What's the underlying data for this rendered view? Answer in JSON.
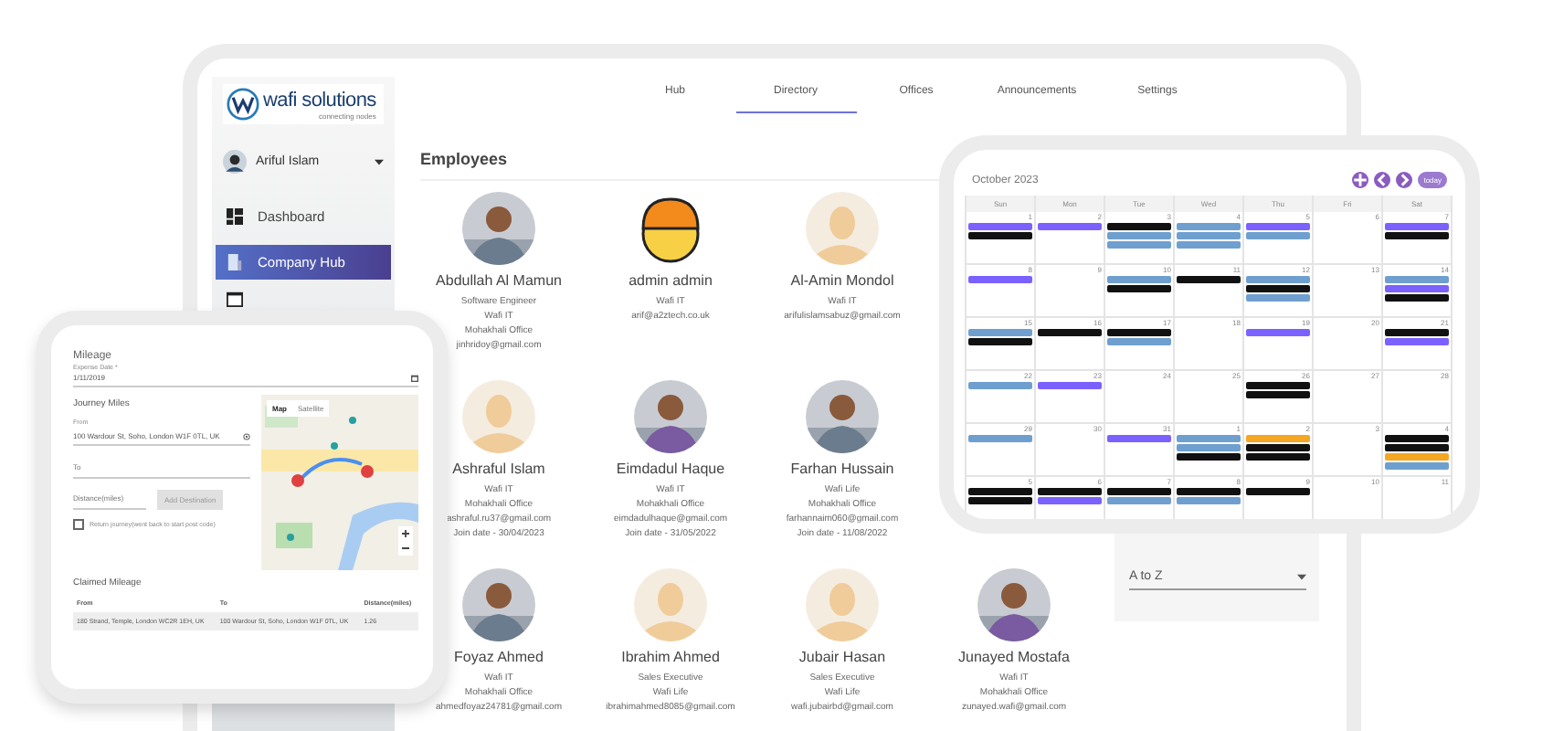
{
  "logo": {
    "name": "wafi solutions",
    "tagline": "connecting nodes"
  },
  "user": {
    "name": "Ariful Islam"
  },
  "sidebar": {
    "items": [
      {
        "label": "Dashboard",
        "selected": false
      },
      {
        "label": "Company Hub",
        "selected": true
      }
    ]
  },
  "tabs": [
    {
      "label": "Hub",
      "selected": false
    },
    {
      "label": "Directory",
      "selected": true
    },
    {
      "label": "Offices",
      "selected": false
    },
    {
      "label": "Announcements",
      "selected": false
    },
    {
      "label": "Settings",
      "selected": false
    }
  ],
  "directory": {
    "title": "Employees",
    "employees": [
      {
        "name": "Abdullah Al Mamun",
        "details": [
          "Software Engineer",
          "Wafi IT",
          "Mohakhali Office",
          "jinhridoy@gmail.com"
        ]
      },
      {
        "name": "admin admin",
        "kind": "helmet",
        "details": [
          "Wafi IT",
          "arif@a2ztech.co.uk"
        ]
      },
      {
        "name": "Al-Amin Mondol",
        "kind": "default",
        "details": [
          "Wafi IT",
          "arifulislamsabuz@gmail.com"
        ]
      },
      {
        "kind": "hidden"
      },
      {
        "name": "Ashraful Islam",
        "kind": "default",
        "details": [
          "Wafi IT",
          "Mohakhali Office",
          "ashraful.ru37@gmail.com",
          "Join date - 30/04/2023"
        ]
      },
      {
        "name": "Eimdadul Haque",
        "details": [
          "Wafi IT",
          "Mohakhali Office",
          "eimdadulhaque@gmail.com",
          "Join date - 31/05/2022"
        ]
      },
      {
        "name": "Farhan Hussain",
        "details": [
          "Wafi Life",
          "Mohakhali Office",
          "farhannaim060@gmail.com",
          "Join date - 11/08/2022"
        ]
      },
      {
        "kind": "hidden"
      },
      {
        "name": "Foyaz Ahmed",
        "details": [
          "Wafi IT",
          "Mohakhali Office",
          "ahmedfoyaz24781@gmail.com"
        ]
      },
      {
        "name": "Ibrahim Ahmed",
        "kind": "default",
        "details": [
          "Sales Executive",
          "Wafi Life",
          "ibrahimahmed8085@gmail.com"
        ]
      },
      {
        "name": "Jubair Hasan",
        "kind": "default",
        "details": [
          "Sales Executive",
          "Wafi Life",
          "wafi.jubairbd@gmail.com"
        ]
      },
      {
        "name": "Junayed Mostafa",
        "details": [
          "Wafi IT",
          "Mohakhali Office",
          "zunayed.wafi@gmail.com"
        ]
      }
    ]
  },
  "sort_field": {
    "value": "A to Z"
  },
  "calendar": {
    "title": "October 2023",
    "today_button": "today",
    "weekdays": [
      "Sun",
      "Mon",
      "Tue",
      "Wed",
      "Thu",
      "Fri",
      "Sat"
    ],
    "weeks": [
      [
        {
          "date": "1",
          "events": [
            {
              "color": "#7b61ff"
            },
            {
              "color": "#111111"
            }
          ]
        },
        {
          "date": "2",
          "events": [
            {
              "color": "#7b61ff"
            }
          ]
        },
        {
          "date": "3",
          "events": [
            {
              "color": "#111111"
            },
            {
              "color": "#6f9fcf"
            },
            {
              "color": "#6f9fcf"
            }
          ]
        },
        {
          "date": "4",
          "events": [
            {
              "color": "#6f9fcf"
            },
            {
              "color": "#6f9fcf"
            },
            {
              "color": "#6f9fcf"
            }
          ]
        },
        {
          "date": "5",
          "events": [
            {
              "color": "#7b61ff"
            },
            {
              "color": "#6f9fcf"
            }
          ]
        },
        {
          "date": "6"
        },
        {
          "date": "7",
          "events": [
            {
              "color": "#7b61ff"
            },
            {
              "color": "#111111"
            }
          ]
        }
      ],
      [
        {
          "date": "8",
          "events": [
            {
              "color": "#7b61ff"
            }
          ]
        },
        {
          "date": "9"
        },
        {
          "date": "10",
          "events": [
            {
              "color": "#6f9fcf"
            },
            {
              "color": "#111111"
            }
          ]
        },
        {
          "date": "11",
          "events": [
            {
              "color": "#111111"
            }
          ]
        },
        {
          "date": "12",
          "events": [
            {
              "color": "#6f9fcf"
            },
            {
              "color": "#111111"
            },
            {
              "color": "#6f9fcf"
            }
          ]
        },
        {
          "date": "13"
        },
        {
          "date": "14",
          "events": [
            {
              "color": "#6f9fcf"
            },
            {
              "color": "#7b61ff"
            },
            {
              "color": "#111111"
            }
          ]
        }
      ],
      [
        {
          "date": "15",
          "events": [
            {
              "color": "#6f9fcf"
            },
            {
              "color": "#111111"
            }
          ]
        },
        {
          "date": "16",
          "events": [
            {
              "color": "#111111"
            }
          ]
        },
        {
          "date": "17",
          "events": [
            {
              "color": "#111111"
            },
            {
              "color": "#6f9fcf"
            }
          ]
        },
        {
          "date": "18"
        },
        {
          "date": "19",
          "events": [
            {
              "color": "#7b61ff"
            }
          ]
        },
        {
          "date": "20"
        },
        {
          "date": "21",
          "events": [
            {
              "color": "#111111"
            },
            {
              "color": "#7b61ff"
            }
          ]
        }
      ],
      [
        {
          "date": "22",
          "events": [
            {
              "color": "#6f9fcf"
            }
          ]
        },
        {
          "date": "23",
          "events": [
            {
              "color": "#7b61ff"
            }
          ]
        },
        {
          "date": "24"
        },
        {
          "date": "25"
        },
        {
          "date": "26",
          "events": [
            {
              "color": "#111111"
            },
            {
              "color": "#111111"
            }
          ]
        },
        {
          "date": "27"
        },
        {
          "date": "28"
        }
      ],
      [
        {
          "date": "29",
          "events": [
            {
              "color": "#6f9fcf"
            }
          ]
        },
        {
          "date": "30"
        },
        {
          "date": "31",
          "events": [
            {
              "color": "#7b61ff"
            }
          ]
        },
        {
          "date": "1",
          "events": [
            {
              "color": "#6f9fcf"
            },
            {
              "color": "#6f9fcf"
            },
            {
              "color": "#111111"
            }
          ]
        },
        {
          "date": "2",
          "events": [
            {
              "color": "#f5a623"
            },
            {
              "color": "#111111"
            },
            {
              "color": "#111111"
            }
          ]
        },
        {
          "date": "3"
        },
        {
          "date": "4",
          "events": [
            {
              "color": "#111111"
            },
            {
              "color": "#111111"
            },
            {
              "color": "#f5a623"
            },
            {
              "color": "#6f9fcf"
            }
          ]
        }
      ],
      [
        {
          "date": "5",
          "events": [
            {
              "color": "#111111"
            },
            {
              "color": "#111111"
            }
          ]
        },
        {
          "date": "6",
          "events": [
            {
              "color": "#111111"
            },
            {
              "color": "#7b61ff"
            }
          ]
        },
        {
          "date": "7",
          "events": [
            {
              "color": "#111111"
            },
            {
              "color": "#6f9fcf"
            }
          ]
        },
        {
          "date": "8",
          "events": [
            {
              "color": "#111111"
            },
            {
              "color": "#6f9fcf"
            }
          ]
        },
        {
          "date": "9",
          "events": [
            {
              "color": "#111111"
            }
          ]
        },
        {
          "date": "10"
        },
        {
          "date": "11"
        }
      ]
    ]
  },
  "mileage": {
    "title": "Mileage",
    "expense_date": {
      "label": "Expense Date *",
      "value": "1/11/2019"
    },
    "journey_title": "Journey Miles",
    "from": {
      "label": "From",
      "value": "100 Wardour St, Soho, London W1F 0TL, UK"
    },
    "to": {
      "placeholder": "To"
    },
    "distance": {
      "placeholder": "Distance(miles)"
    },
    "add_button": "Add Destination",
    "return_journey": {
      "label": "Return journey(went back to start post code)",
      "checked": false
    },
    "map_buttons": [
      {
        "label": "Map",
        "selected": true
      },
      {
        "label": "Satellite",
        "selected": false
      }
    ],
    "claimed_title": "Claimed Mileage",
    "table": {
      "columns": [
        "From",
        "To",
        "Distance(miles)"
      ],
      "rows": [
        [
          "180 Strand, Temple, London WC2R 1EH, UK",
          "100 Wardour St, Soho, London W1F 0TL, UK",
          "1.26"
        ]
      ]
    }
  }
}
